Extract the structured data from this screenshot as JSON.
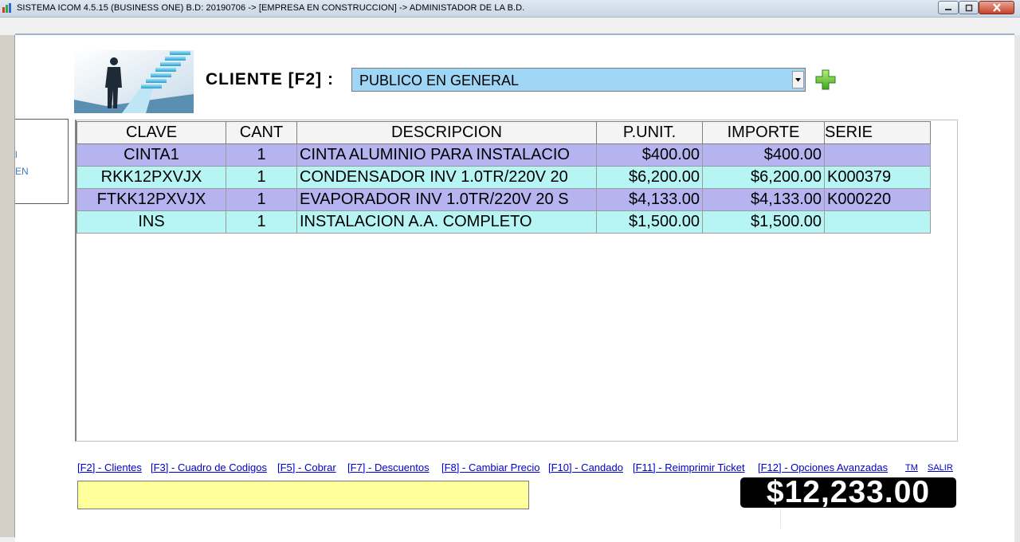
{
  "window": {
    "title": "SISTEMA ICOM 4.5.15 (BUSINESS ONE)  B.D: 20190706  ->  [EMPRESA EN CONSTRUCCION]  ->  ADMINISTADOR DE LA B.D.",
    "min_icon": "minimize-icon",
    "max_icon": "maximize-icon",
    "close_icon": "close-icon"
  },
  "side": {
    "text_top": "l",
    "text_bottom": "EN"
  },
  "header": {
    "client_label": "CLIENTE  [F2] :",
    "client_value": "PUBLICO EN GENERAL",
    "add_icon": "plus-icon"
  },
  "grid": {
    "columns": [
      "CLAVE",
      "CANT",
      "DESCRIPCION",
      "P.UNIT.",
      "IMPORTE",
      "SERIE"
    ],
    "rows": [
      {
        "clave": "CINTA1",
        "cant": "1",
        "descripcion": "CINTA ALUMINIO PARA INSTALACIO",
        "punit": "$400.00",
        "importe": "$400.00",
        "serie": ""
      },
      {
        "clave": "RKK12PXVJX",
        "cant": "1",
        "descripcion": "CONDENSADOR INV 1.0TR/220V 20",
        "punit": "$6,200.00",
        "importe": "$6,200.00",
        "serie": "K000379"
      },
      {
        "clave": "FTKK12PXVJX",
        "cant": "1",
        "descripcion": "EVAPORADOR INV 1.0TR/220V 20 S",
        "punit": "$4,133.00",
        "importe": "$4,133.00",
        "serie": "K000220"
      },
      {
        "clave": "INS",
        "cant": "1",
        "descripcion": "INSTALACION A.A. COMPLETO",
        "punit": "$1,500.00",
        "importe": "$1,500.00",
        "serie": ""
      }
    ]
  },
  "shortcuts": {
    "clientes": "[F2] - Clientes",
    "codigos": "[F3] - Cuadro de Codigos",
    "cobrar": "[F5] - Cobrar",
    "descuentos": "[F7] - Descuentos",
    "cambiar_precio": "[F8] - Cambiar Precio",
    "candado": "[F10] - Candado",
    "reimprimir": "[F11] - Reimprimir Ticket",
    "opciones": "[F12] - Opciones Avanzadas",
    "tm": "TM",
    "salir": "SALIR"
  },
  "footer": {
    "message": "",
    "total": "$12,233.00"
  },
  "colors": {
    "row_even": "#b5b3f0",
    "row_odd": "#b6f5f4",
    "select_bg": "#9fd6f5",
    "message_bg": "#ffff9c",
    "total_bg": "#000000",
    "link": "#0000cc"
  }
}
